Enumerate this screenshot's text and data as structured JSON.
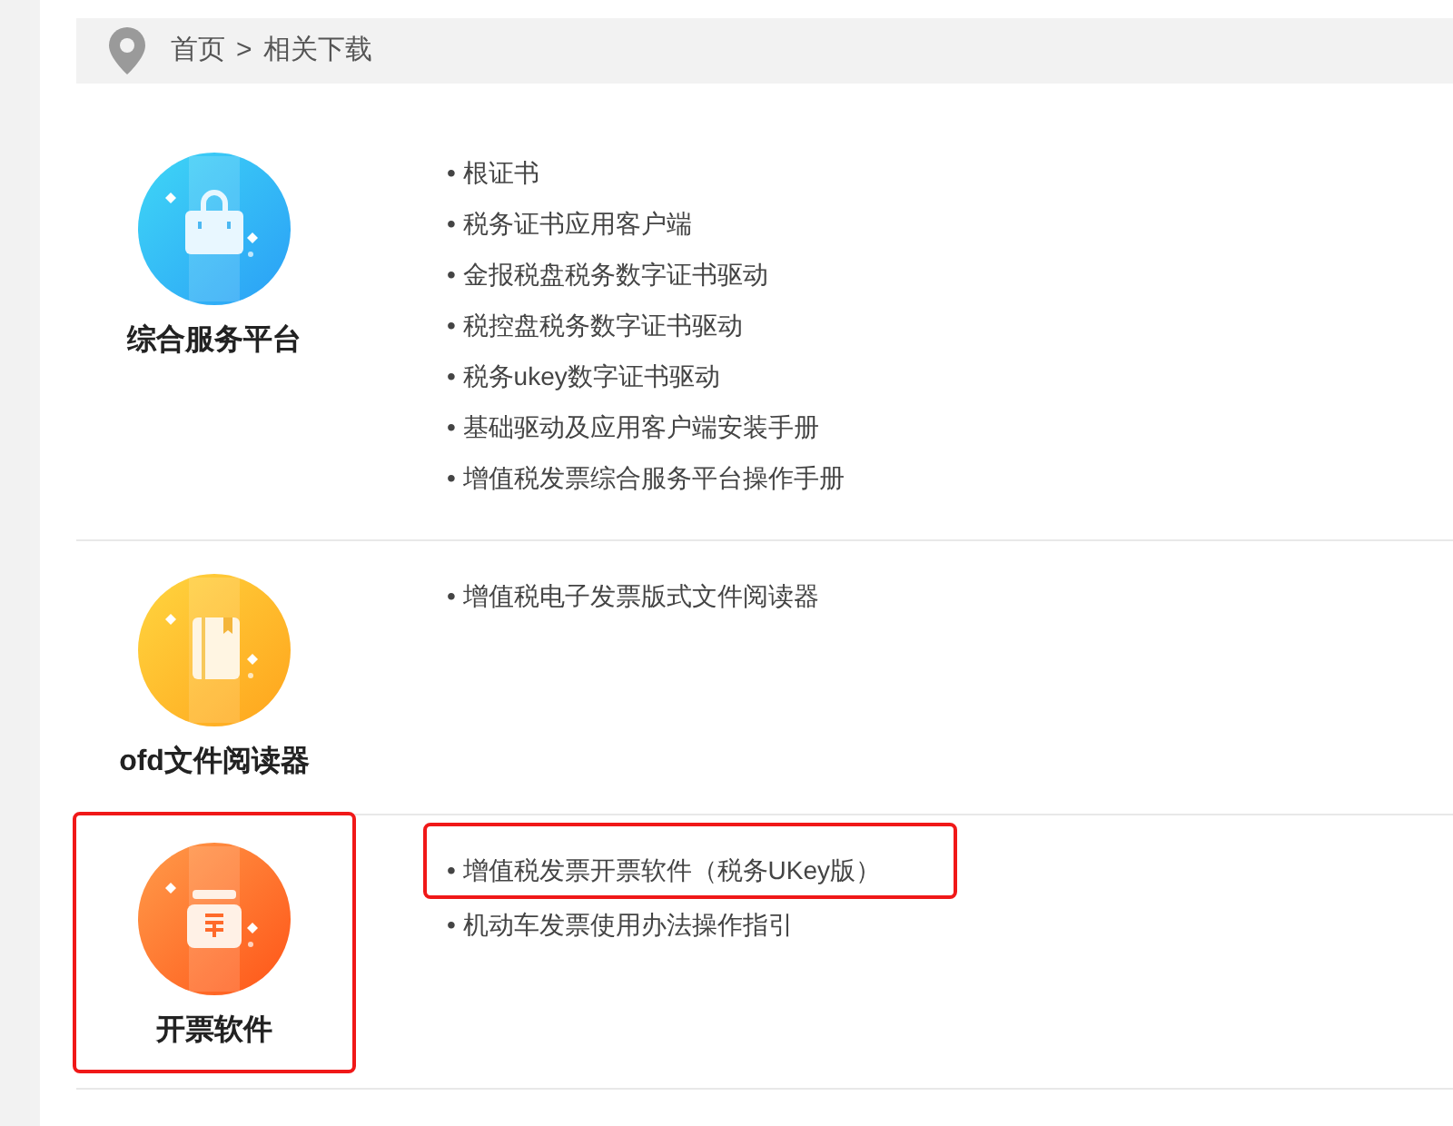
{
  "breadcrumb": {
    "items": [
      "首页",
      "相关下载"
    ],
    "separator": ">"
  },
  "sections": [
    {
      "title": "综合服务平台",
      "kind": "briefcase",
      "highlighted": false,
      "links": [
        {
          "text": "• 根证书",
          "highlighted": false
        },
        {
          "text": "• 税务证书应用客户端",
          "highlighted": false
        },
        {
          "text": "• 金报税盘税务数字证书驱动",
          "highlighted": false
        },
        {
          "text": "• 税控盘税务数字证书驱动",
          "highlighted": false
        },
        {
          "text": "• 税务ukey数字证书驱动",
          "highlighted": false
        },
        {
          "text": "• 基础驱动及应用客户端安装手册",
          "highlighted": false
        },
        {
          "text": "• 增值税发票综合服务平台操作手册",
          "highlighted": false
        }
      ]
    },
    {
      "title": "ofd文件阅读器",
      "kind": "book",
      "highlighted": false,
      "links": [
        {
          "text": "• 增值税电子发票版式文件阅读器",
          "highlighted": false
        }
      ]
    },
    {
      "title": "开票软件",
      "kind": "cashbox",
      "highlighted": true,
      "links": [
        {
          "text": "• 增值税发票开票软件（税务UKey版）",
          "highlighted": true
        },
        {
          "text": "• 机动车发票使用办法操作指引",
          "highlighted": false
        }
      ]
    }
  ]
}
